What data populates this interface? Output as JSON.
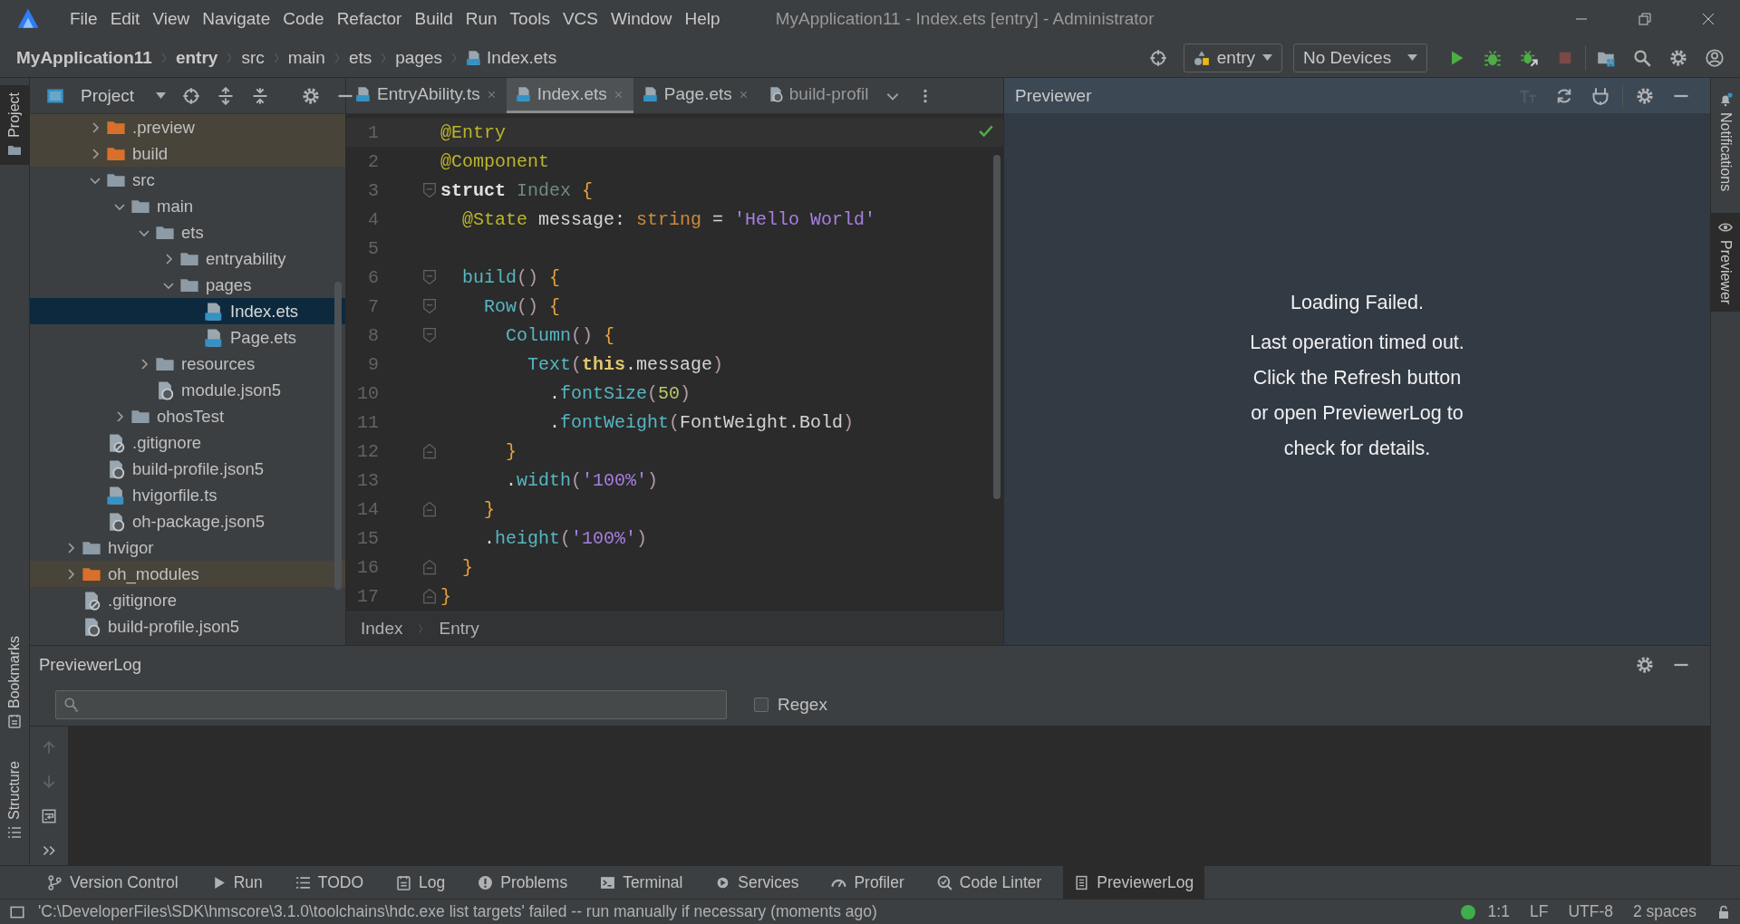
{
  "menu_bar": {
    "items": [
      "File",
      "Edit",
      "View",
      "Navigate",
      "Code",
      "Refactor",
      "Build",
      "Run",
      "Tools",
      "VCS",
      "Window",
      "Help"
    ],
    "title": "MyApplication11 - Index.ets [entry] - Administrator"
  },
  "nav_bar": {
    "breadcrumbs": [
      {
        "label": "MyApplication11",
        "kind": "project"
      },
      {
        "label": "entry",
        "kind": "module"
      },
      {
        "label": "src",
        "kind": "folder"
      },
      {
        "label": "main",
        "kind": "folder"
      },
      {
        "label": "ets",
        "kind": "folder"
      },
      {
        "label": "pages",
        "kind": "folder"
      },
      {
        "label": "Index.ets",
        "kind": "file"
      }
    ],
    "module_selector": "entry",
    "device_selector": "No Devices",
    "actions": [
      {
        "kind": "run",
        "disabled": false
      },
      {
        "kind": "debug",
        "disabled": false
      },
      {
        "kind": "attach-debug",
        "disabled": false
      },
      {
        "kind": "stop",
        "disabled": true
      }
    ]
  },
  "left_strip": {
    "tabs": [
      {
        "label": "Project",
        "selected": true
      },
      {
        "label": "Bookmarks",
        "selected": false
      },
      {
        "label": "Structure",
        "selected": false
      }
    ]
  },
  "project_panel": {
    "title": "Project",
    "scrolled_branch_children": [
      {
        "label": ".preview",
        "kind": "excluded-folder",
        "expanded": false,
        "selected": false
      },
      {
        "label": "build",
        "kind": "excluded-folder",
        "expanded": false,
        "selected": false
      },
      {
        "label": "src",
        "kind": "folder",
        "expanded": true,
        "selected": false,
        "children": [
          {
            "label": "main",
            "kind": "folder",
            "expanded": true,
            "selected": false,
            "children": [
              {
                "label": "ets",
                "kind": "folder",
                "expanded": true,
                "selected": false,
                "children": [
                  {
                    "label": "entryability",
                    "kind": "folder",
                    "expanded": false,
                    "selected": false
                  },
                  {
                    "label": "pages",
                    "kind": "folder",
                    "expanded": true,
                    "selected": false,
                    "children": [
                      {
                        "label": "Index.ets",
                        "kind": "ets-file",
                        "selected": true
                      },
                      {
                        "label": "Page.ets",
                        "kind": "ets-file",
                        "selected": false
                      }
                    ]
                  }
                ]
              },
              {
                "label": "resources",
                "kind": "folder",
                "expanded": false,
                "selected": false
              },
              {
                "label": "module.json5",
                "kind": "json-file",
                "selected": false
              }
            ]
          },
          {
            "label": "ohosTest",
            "kind": "folder",
            "expanded": false,
            "selected": false
          }
        ]
      },
      {
        "label": ".gitignore",
        "kind": "ignore-file",
        "selected": false
      },
      {
        "label": "build-profile.json5",
        "kind": "json-file",
        "selected": false
      },
      {
        "label": "hvigorfile.ts",
        "kind": "ts-file",
        "selected": false
      },
      {
        "label": "oh-package.json5",
        "kind": "json-file",
        "selected": false
      }
    ],
    "items": [
      {
        "label": "hvigor",
        "kind": "folder",
        "expanded": false,
        "selected": false
      },
      {
        "label": "oh_modules",
        "kind": "excluded-folder",
        "expanded": false,
        "selected": false
      },
      {
        "label": ".gitignore",
        "kind": "ignore-file",
        "selected": false
      },
      {
        "label": "build-profile.json5",
        "kind": "json-file",
        "selected": false
      }
    ]
  },
  "editor": {
    "tabs": [
      {
        "label": "EntryAbility.ts",
        "kind": "ts-file",
        "selected": false
      },
      {
        "label": "Index.ets",
        "kind": "ets-file",
        "selected": true
      },
      {
        "label": "Page.ets",
        "kind": "ets-file",
        "selected": false
      },
      {
        "label": "build-profil",
        "kind": "json-file",
        "selected": false
      }
    ],
    "lines": [
      {
        "number": "1",
        "kind": "plain",
        "tokens": [
          {
            "kind": "annotation",
            "text": "@Entry"
          }
        ]
      },
      {
        "number": "2",
        "kind": "plain",
        "tokens": [
          {
            "kind": "annotation",
            "text": "@Component"
          }
        ]
      },
      {
        "number": "3",
        "kind": "fold-start",
        "tokens": [
          {
            "kind": "keyword",
            "text": "struct "
          },
          {
            "kind": "unused",
            "text": "Index "
          },
          {
            "kind": "brace",
            "text": "{"
          }
        ]
      },
      {
        "number": "4",
        "kind": "plain",
        "tokens": [
          {
            "kind": "annotation",
            "text": "  @State"
          },
          {
            "kind": "ident",
            "text": " message: "
          },
          {
            "kind": "type",
            "text": "string"
          },
          {
            "kind": "ident",
            "text": " = "
          },
          {
            "kind": "string",
            "text": "'Hello World'"
          }
        ]
      },
      {
        "number": "5",
        "kind": "plain"
      },
      {
        "number": "6",
        "kind": "fold-start",
        "tokens": [
          {
            "kind": "call",
            "text": "  build"
          },
          {
            "kind": "paren",
            "text": "() "
          },
          {
            "kind": "brace",
            "text": "{"
          }
        ]
      },
      {
        "number": "7",
        "kind": "fold-start",
        "tokens": [
          {
            "kind": "call",
            "text": "    Row"
          },
          {
            "kind": "paren",
            "text": "() "
          },
          {
            "kind": "brace",
            "text": "{"
          }
        ]
      },
      {
        "number": "8",
        "kind": "fold-start",
        "tokens": [
          {
            "kind": "call",
            "text": "      Column"
          },
          {
            "kind": "paren",
            "text": "() "
          },
          {
            "kind": "brace",
            "text": "{"
          }
        ]
      },
      {
        "number": "9",
        "kind": "plain",
        "tokens": [
          {
            "kind": "call",
            "text": "        Text"
          },
          {
            "kind": "paren",
            "text": "("
          },
          {
            "kind": "this",
            "text": "this"
          },
          {
            "kind": "ident",
            "text": ".message"
          },
          {
            "kind": "paren",
            "text": ")"
          }
        ]
      },
      {
        "number": "10",
        "kind": "plain",
        "tokens": [
          {
            "kind": "ident",
            "text": "          ."
          },
          {
            "kind": "call",
            "text": "fontSize"
          },
          {
            "kind": "paren",
            "text": "("
          },
          {
            "kind": "number",
            "text": "50"
          },
          {
            "kind": "paren",
            "text": ")"
          }
        ]
      },
      {
        "number": "11",
        "kind": "plain",
        "tokens": [
          {
            "kind": "ident",
            "text": "          ."
          },
          {
            "kind": "call",
            "text": "fontWeight"
          },
          {
            "kind": "paren",
            "text": "("
          },
          {
            "kind": "ident",
            "text": "FontWeight.Bold"
          },
          {
            "kind": "paren",
            "text": ")"
          }
        ]
      },
      {
        "number": "12",
        "kind": "fold-end",
        "tokens": [
          {
            "kind": "brace",
            "text": "      }"
          }
        ]
      },
      {
        "number": "13",
        "kind": "plain",
        "tokens": [
          {
            "kind": "ident",
            "text": "      ."
          },
          {
            "kind": "call",
            "text": "width"
          },
          {
            "kind": "paren",
            "text": "("
          },
          {
            "kind": "string",
            "text": "'100%'"
          },
          {
            "kind": "paren",
            "text": ")"
          }
        ]
      },
      {
        "number": "14",
        "kind": "fold-end",
        "tokens": [
          {
            "kind": "brace",
            "text": "    }"
          }
        ]
      },
      {
        "number": "15",
        "kind": "plain",
        "tokens": [
          {
            "kind": "ident",
            "text": "    ."
          },
          {
            "kind": "call",
            "text": "height"
          },
          {
            "kind": "paren",
            "text": "("
          },
          {
            "kind": "string",
            "text": "'100%'"
          },
          {
            "kind": "paren",
            "text": ")"
          }
        ]
      },
      {
        "number": "16",
        "kind": "fold-end",
        "tokens": [
          {
            "kind": "brace",
            "text": "  }"
          }
        ]
      },
      {
        "number": "17",
        "kind": "fold-end",
        "tokens": [
          {
            "kind": "brace",
            "text": "}"
          }
        ]
      }
    ],
    "breadcrumbs": [
      "Index",
      "Entry"
    ]
  },
  "previewer": {
    "title": "Previewer",
    "tools": [
      {
        "kind": "text-size",
        "disabled": true
      },
      {
        "kind": "refresh",
        "disabled": false
      },
      {
        "kind": "plug",
        "disabled": false
      }
    ],
    "heading": "Loading Failed.",
    "message_lines": [
      "Last operation timed out.",
      "Click the Refresh button",
      "or open PreviewerLog to",
      "check for details."
    ]
  },
  "right_strip": {
    "tabs": [
      {
        "label": "Notifications",
        "kind": "bell",
        "selected": false
      },
      {
        "label": "Previewer",
        "kind": "eye",
        "selected": true
      }
    ]
  },
  "log_panel": {
    "title": "PreviewerLog",
    "regex": {
      "label": "Regex",
      "checked": false
    },
    "side_tools": [
      {
        "kind": "up",
        "disabled": true
      },
      {
        "kind": "down",
        "disabled": true
      },
      {
        "kind": "wrap",
        "disabled": false
      },
      {
        "kind": "more",
        "disabled": false
      }
    ]
  },
  "tool_bar": {
    "items": [
      {
        "label": "Version Control",
        "kind": "branch",
        "selected": false
      },
      {
        "label": "Run",
        "kind": "play",
        "selected": false
      },
      {
        "label": "TODO",
        "kind": "list",
        "selected": false
      },
      {
        "label": "Log",
        "kind": "notebook",
        "selected": false
      },
      {
        "label": "Problems",
        "kind": "warning",
        "selected": false
      },
      {
        "label": "Terminal",
        "kind": "terminal",
        "selected": false
      },
      {
        "label": "Services",
        "kind": "services",
        "selected": false
      },
      {
        "label": "Profiler",
        "kind": "gauge",
        "selected": false
      },
      {
        "label": "Code Linter",
        "kind": "linter",
        "selected": false
      },
      {
        "label": "PreviewerLog",
        "kind": "document",
        "selected": true
      }
    ]
  },
  "status_bar": {
    "message": "'C:\\DeveloperFiles\\SDK\\hmscore\\3.1.0\\toolchains\\hdc.exe list targets' failed -- run manually if necessary (moments ago)",
    "position": "1:1",
    "line_ending": "LF",
    "encoding": "UTF-8",
    "indent": "2 spaces"
  }
}
